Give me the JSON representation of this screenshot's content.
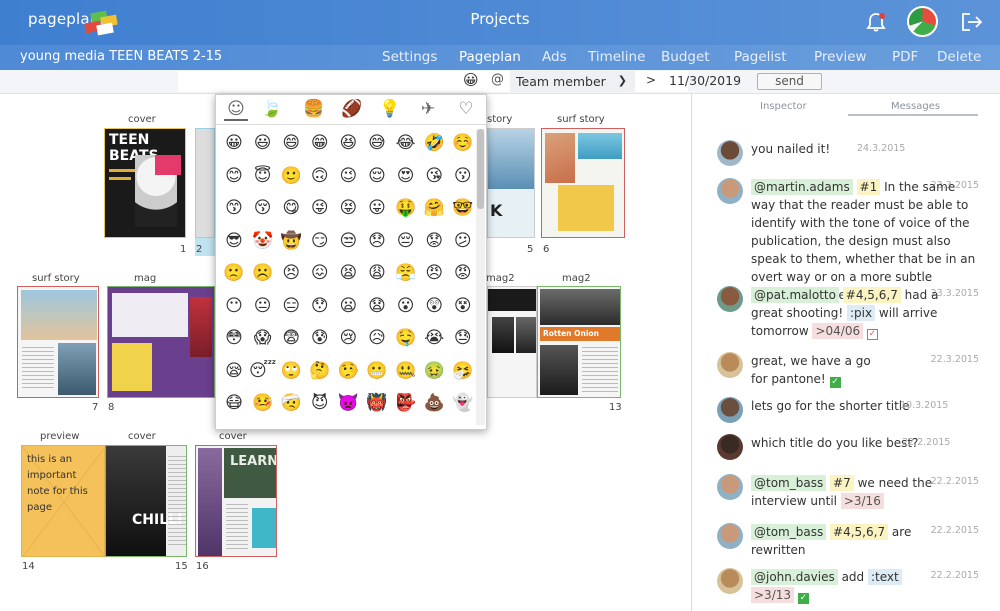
{
  "app": {
    "logo": "pageplanr",
    "title": "Projects",
    "project_name": "young media TEEN BEATS 2-15"
  },
  "nav": [
    "Settings",
    "Pageplan",
    "Ads",
    "Timeline",
    "Budget",
    "Pagelist",
    "Preview",
    "PDF",
    "Delete"
  ],
  "toolbar": {
    "at": "@",
    "member": "Team member",
    "gt": ">",
    "date": "11/30/2019",
    "send": "send"
  },
  "plan": {
    "labels": [
      "cover",
      "story",
      "surf story",
      "surf story",
      "mag",
      "mag2",
      "mag2",
      "preview",
      "cover",
      "cover"
    ],
    "page_numbers": [
      "1",
      "2",
      "5",
      "6",
      "7",
      "8",
      "13",
      "14",
      "15",
      "16"
    ],
    "note": "this is an important note for this page",
    "thumb_text": {
      "teen_beats": "TEEN BEATS",
      "learn": "LEARN",
      "rotten_onion": "Rotten Onion",
      "chilli": "CHILLI",
      "k": "K"
    }
  },
  "emoji_tabs": [
    "smileys",
    "nature",
    "food",
    "sports",
    "ideas",
    "travel",
    "symbols"
  ],
  "emojis": [
    "😀",
    "😃",
    "😄",
    "😁",
    "😆",
    "😅",
    "😂",
    "🤣",
    "☺️",
    "😊",
    "😇",
    "🙂",
    "🙃",
    "😉",
    "😌",
    "😍",
    "😘",
    "😗",
    "😙",
    "😚",
    "😋",
    "😜",
    "😝",
    "😛",
    "🤑",
    "🤗",
    "🤓",
    "😎",
    "🤡",
    "🤠",
    "😏",
    "😒",
    "😞",
    "😔",
    "😟",
    "😕",
    "🙁",
    "☹️",
    "😣",
    "😖",
    "😫",
    "😩",
    "😤",
    "😠",
    "😡",
    "😶",
    "😐",
    "😑",
    "😯",
    "😦",
    "😧",
    "😮",
    "😲",
    "😵",
    "😳",
    "😱",
    "😨",
    "😰",
    "😢",
    "😥",
    "🤤",
    "😭",
    "😓",
    "😪",
    "😴",
    "🙄",
    "🤔",
    "🤥",
    "😬",
    "🤐",
    "🤢",
    "🤧",
    "😷",
    "🤒",
    "🤕",
    "😈",
    "👿",
    "👹",
    "👺",
    "💩",
    "👻"
  ],
  "panel": {
    "tab_inspector": "Inspector",
    "tab_messages": "Messages"
  },
  "messages": [
    {
      "date": "24.3.2015",
      "text": "you nailed it!"
    },
    {
      "date": "23.3.2015",
      "user": "@martin.adams",
      "page": "#1",
      "text": "In the same way that the reader must be able to identify with the tone of voice of the publication, the design must also speak to them, whether that be in an overt way or on a more subtle subconscious level."
    },
    {
      "date": "23.3.2015",
      "user": "@pat.malotto",
      "page": "#4,5,6,7",
      "text1": "had a great shooting!",
      "pix": ":pix",
      "text2": "will arrive tomorrow",
      "due": ">04/06"
    },
    {
      "date": "22.3.2015",
      "text": "great, we have a go for pantone!"
    },
    {
      "date": "10.3.2015",
      "text": "lets go for the shorter title"
    },
    {
      "date": "22.2.2015",
      "text": "which title do you like best?"
    },
    {
      "date": "22.2.2015",
      "user": "@tom_bass",
      "page": "#7",
      "text": "we need the interview until",
      "due": ">3/16"
    },
    {
      "date": "22.2.2015",
      "user": "@tom_bass",
      "page": "#4,5,6,7",
      "text": "are rewritten"
    },
    {
      "date": "22.2.2015",
      "user": "@john.davies",
      "text": "add",
      "pix": ":text",
      "due": ">3/13"
    }
  ],
  "colors": {
    "topbar": "#4a87d4",
    "user_tag": "#d8efd8",
    "page_tag": "#fbf3c1",
    "pix_tag": "#dcebf4",
    "due_tag": "#f6dede",
    "check": "#3fae49"
  }
}
